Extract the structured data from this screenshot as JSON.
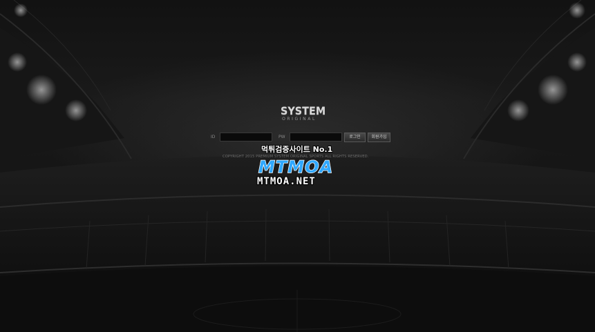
{
  "logo": {
    "main": "SYSTEM",
    "sub": "ORIGINAL"
  },
  "login": {
    "id_label": "ID",
    "pw_label": "PW",
    "id_value": "",
    "pw_value": "",
    "login_button": "로그인",
    "join_button": "회원가입"
  },
  "footer": {
    "copyright": "COPYRIGHT 2015 PREMIUM SYSTEM ORIGINAL SPORTS ALL RIGHTS RESERVED."
  },
  "watermark": {
    "tagline": "먹튀검증사이트 No.1",
    "logo_text": "MTMOA",
    "url": "MTMOA.NET"
  },
  "colors": {
    "background": "#0b0b0b",
    "accent_blue": "#2fa8ff",
    "text_gray": "#8a8a8a"
  },
  "icons": {
    "background": "stadium-background-icon"
  }
}
